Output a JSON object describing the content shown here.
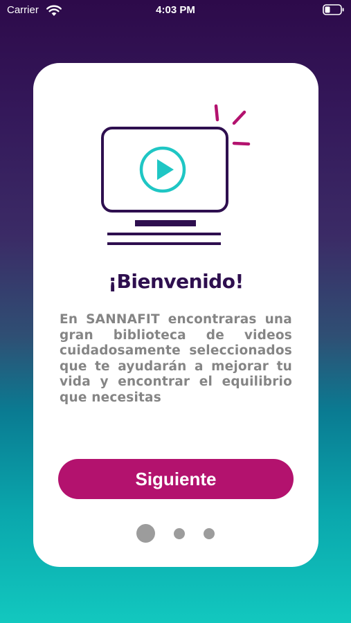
{
  "status_bar": {
    "carrier": "Carrier",
    "time": "4:03 PM",
    "wifi_icon": "wifi-icon",
    "battery_icon": "battery-icon"
  },
  "onboarding": {
    "illustration_icon": "video-monitor-icon",
    "title": "¡Bienvenido!",
    "description": "En SANNAFIT encontraras una gran biblioteca de videos cuidadosamente seleccionados que te ayudarán a mejorar tu vida y encontrar el equilibrio que necesitas",
    "next_button_label": "Siguiente",
    "pages_total": 3,
    "current_page": 1
  },
  "colors": {
    "primary": "#2e0f4f",
    "accent": "#b3126e",
    "teal": "#1fc6c4",
    "text_gray": "#858585",
    "dot_gray": "#9c9c9c"
  }
}
